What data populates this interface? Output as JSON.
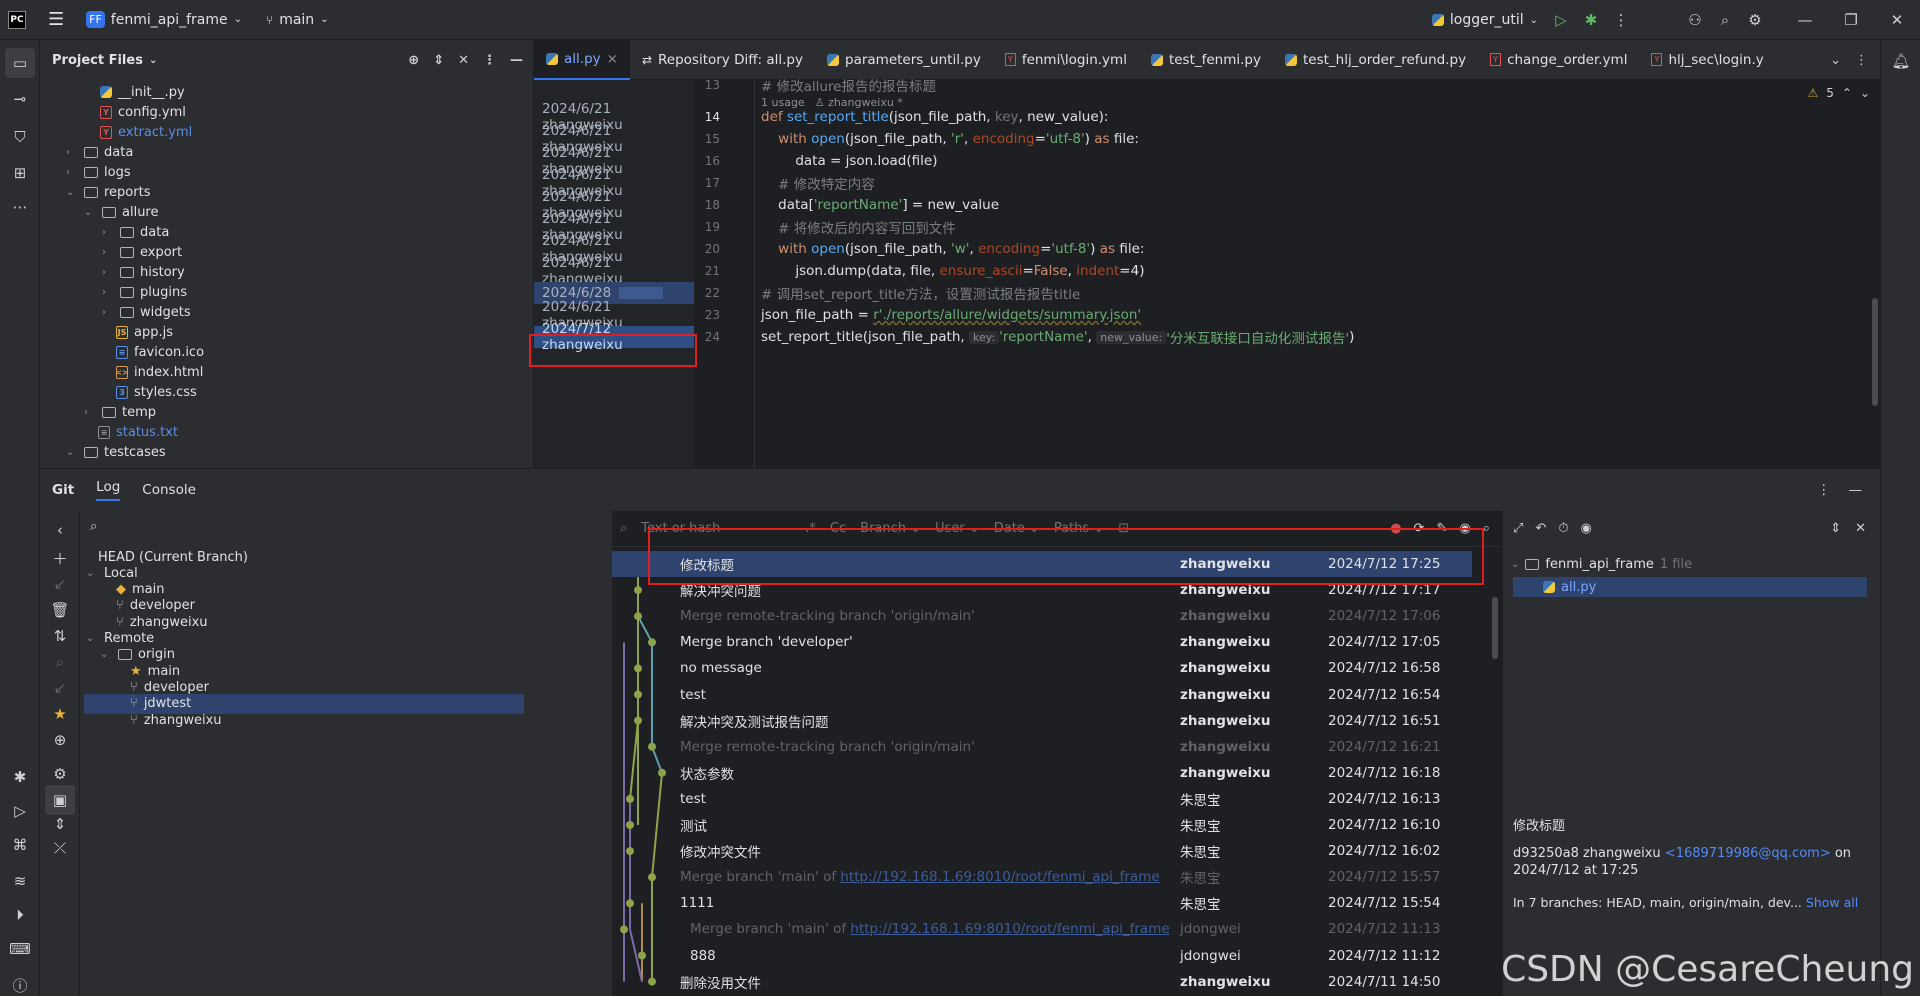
{
  "topbar": {
    "project_badge": "FF",
    "project_name": "fenmi_api_frame",
    "branch": "main",
    "run_config": "logger_util"
  },
  "project_panel": {
    "title": "Project Files",
    "tree": [
      {
        "label": "__init__.py",
        "kind": "py"
      },
      {
        "label": "config.yml",
        "kind": "yml"
      },
      {
        "label": "extract.yml",
        "kind": "yml"
      },
      {
        "label": "data",
        "kind": "folder"
      },
      {
        "label": "logs",
        "kind": "folder"
      },
      {
        "label": "reports",
        "kind": "folder"
      },
      {
        "label": "allure",
        "kind": "folder"
      },
      {
        "label": "data",
        "kind": "folder"
      },
      {
        "label": "export",
        "kind": "folder"
      },
      {
        "label": "history",
        "kind": "folder"
      },
      {
        "label": "plugins",
        "kind": "folder"
      },
      {
        "label": "widgets",
        "kind": "folder"
      },
      {
        "label": "app.js",
        "kind": "js"
      },
      {
        "label": "favicon.ico",
        "kind": "ico"
      },
      {
        "label": "index.html",
        "kind": "html"
      },
      {
        "label": "styles.css",
        "kind": "css"
      },
      {
        "label": "temp",
        "kind": "folder"
      },
      {
        "label": "status.txt",
        "kind": "txt"
      },
      {
        "label": "testcases",
        "kind": "folder"
      }
    ]
  },
  "editor": {
    "tabs": [
      "all.py",
      "Repository Diff: all.py",
      "parameters_until.py",
      "fenmi\\login.yml",
      "test_fenmi.py",
      "test_hlj_order_refund.py",
      "change_order.yml",
      "hlj_sec\\login.y"
    ],
    "warnings": "5",
    "top_comment": "# 修改allure报告的报告标题",
    "usage_hint": "1 usage",
    "usage_author": "zhangweixu *",
    "blame": [
      "2024/6/21 zhangweixu",
      "2024/6/21 zhangweixu",
      "2024/6/21 zhangweixu",
      "2024/6/21 zhangweixu",
      "2024/6/21 zhangweixu",
      "2024/6/21 zhangweixu",
      "2024/6/21 zhangweixu",
      "2024/6/21 zhangweixu",
      "2024/6/28",
      "2024/6/21 zhangweixu",
      "2024/7/12 zhangweixu"
    ],
    "line_numbers": [
      "13",
      "14",
      "15",
      "16",
      "17",
      "18",
      "19",
      "20",
      "21",
      "22",
      "23",
      "24"
    ],
    "code": {
      "l14_a": "def ",
      "l14_b": "set_report_title",
      "l14_c": "(json_file_path, ",
      "l14_d": "key",
      "l14_e": ", new_value):",
      "l15_a": "    with ",
      "l15_b": "open",
      "l15_c": "(json_file_path, ",
      "l15_d": "'r'",
      "l15_e": ", ",
      "l15_f": "encoding",
      "l15_g": "=",
      "l15_h": "'utf-8'",
      "l15_i": ") ",
      "l15_j": "as ",
      "l15_k": "file:",
      "l16": "        data = json.load(file)",
      "l17": "    # 修改特定内容",
      "l18_a": "    data[",
      "l18_b": "'reportName'",
      "l18_c": "] = new_value",
      "l19": "    # 将修改后的内容写回到文件",
      "l20_a": "    with ",
      "l20_b": "open",
      "l20_c": "(json_file_path, ",
      "l20_d": "'w'",
      "l20_e": ", ",
      "l20_f": "encoding",
      "l20_g": "=",
      "l20_h": "'utf-8'",
      "l20_i": ") ",
      "l20_j": "as ",
      "l20_k": "file:",
      "l21_a": "        json.dump(data, file, ",
      "l21_b": "ensure_ascii",
      "l21_c": "=",
      "l21_d": "False",
      "l21_e": ", ",
      "l21_f": "indent",
      "l21_g": "=4)",
      "l22": "# 调用set_report_title方法，设置测试报告报告title",
      "l23_a": "json_file_path = ",
      "l23_b": "r'./reports/allure/widgets/summary.json'",
      "l24_a": "set_report_title(json_file_path, ",
      "l24_hint1": "key:",
      "l24_b": "'reportName'",
      "l24_c": ", ",
      "l24_hint2": "new_value:",
      "l24_d": "'分米互联接口自动化测试报告'",
      "l24_e": ")"
    }
  },
  "git_panel": {
    "tabs": [
      "Git",
      "Log",
      "Console"
    ],
    "branches": {
      "head": "HEAD (Current Branch)",
      "local_label": "Local",
      "local": [
        "main",
        "developer",
        "zhangweixu"
      ],
      "remote_label": "Remote",
      "origin_label": "origin",
      "remote": [
        "main",
        "developer",
        "jdwtest",
        "zhangweixu"
      ]
    },
    "filter": {
      "placeholder": "Text or hash",
      "branch": "Branch",
      "user": "User",
      "date": "Date",
      "paths": "Paths"
    },
    "commits": [
      {
        "msg": "修改标题",
        "author": "zhangweixu",
        "date": "2024/7/12 17:25",
        "dim": false
      },
      {
        "msg": "解决冲突问题",
        "author": "zhangweixu",
        "date": "2024/7/12 17:17",
        "dim": false
      },
      {
        "msg": "Merge remote-tracking branch 'origin/main'",
        "author": "zhangweixu",
        "date": "2024/7/12 17:06",
        "dim": true
      },
      {
        "msg": "Merge branch 'developer'",
        "author": "zhangweixu",
        "date": "2024/7/12 17:05",
        "dim": false
      },
      {
        "msg": "no message",
        "author": "zhangweixu",
        "date": "2024/7/12 16:58",
        "dim": false
      },
      {
        "msg": "test",
        "author": "zhangweixu",
        "date": "2024/7/12 16:54",
        "dim": false
      },
      {
        "msg": "解决冲突及测试报告问题",
        "author": "zhangweixu",
        "date": "2024/7/12 16:51",
        "dim": false
      },
      {
        "msg": "Merge remote-tracking branch 'origin/main'",
        "author": "zhangweixu",
        "date": "2024/7/12 16:21",
        "dim": true
      },
      {
        "msg": "状态参数",
        "author": "zhangweixu",
        "date": "2024/7/12 16:18",
        "dim": false
      },
      {
        "msg": "test",
        "author": "朱思宝",
        "date": "2024/7/12 16:13",
        "dim": false
      },
      {
        "msg": "测试",
        "author": "朱思宝",
        "date": "2024/7/12 16:10",
        "dim": false
      },
      {
        "msg": "修改冲突文件",
        "author": "朱思宝",
        "date": "2024/7/12 16:02",
        "dim": false
      },
      {
        "msg": "Merge branch 'main' of ",
        "link": "http://192.168.1.69:8010/root/fenmi_api_frame",
        "author": "朱思宝",
        "date": "2024/7/12 15:57",
        "dim": true
      },
      {
        "msg": "1111",
        "author": "朱思宝",
        "date": "2024/7/12 15:54",
        "dim": false
      },
      {
        "msg": "Merge branch 'main' of ",
        "link": "http://192.168.1.69:8010/root/fenmi_api_frame",
        "author": "jdongwei",
        "date": "2024/7/12 11:13",
        "dim": true
      },
      {
        "msg": "888",
        "author": "jdongwei",
        "date": "2024/7/12 11:12",
        "dim": false
      },
      {
        "msg": "删除没用文件",
        "author": "zhangweixu",
        "date": "2024/7/11 14:50",
        "dim": false
      }
    ],
    "details": {
      "root": "fenmi_api_frame",
      "file_count": "1 file",
      "file": "all.py",
      "title": "修改标题",
      "hash_author": "d93250a8 zhangweixu ",
      "email": "<1689719986@qq.com>",
      "on": " on",
      "datetime": "2024/7/12 at 17:25",
      "branches": "In 7 branches: HEAD, main, origin/main, dev...",
      "show_all": "Show all"
    }
  },
  "watermark": "CSDN @CesareCheung",
  "colors": {
    "accent": "#3574f0",
    "highlight_box": "#e02020",
    "background": "#1e1f22",
    "panel": "#2b2d30"
  }
}
